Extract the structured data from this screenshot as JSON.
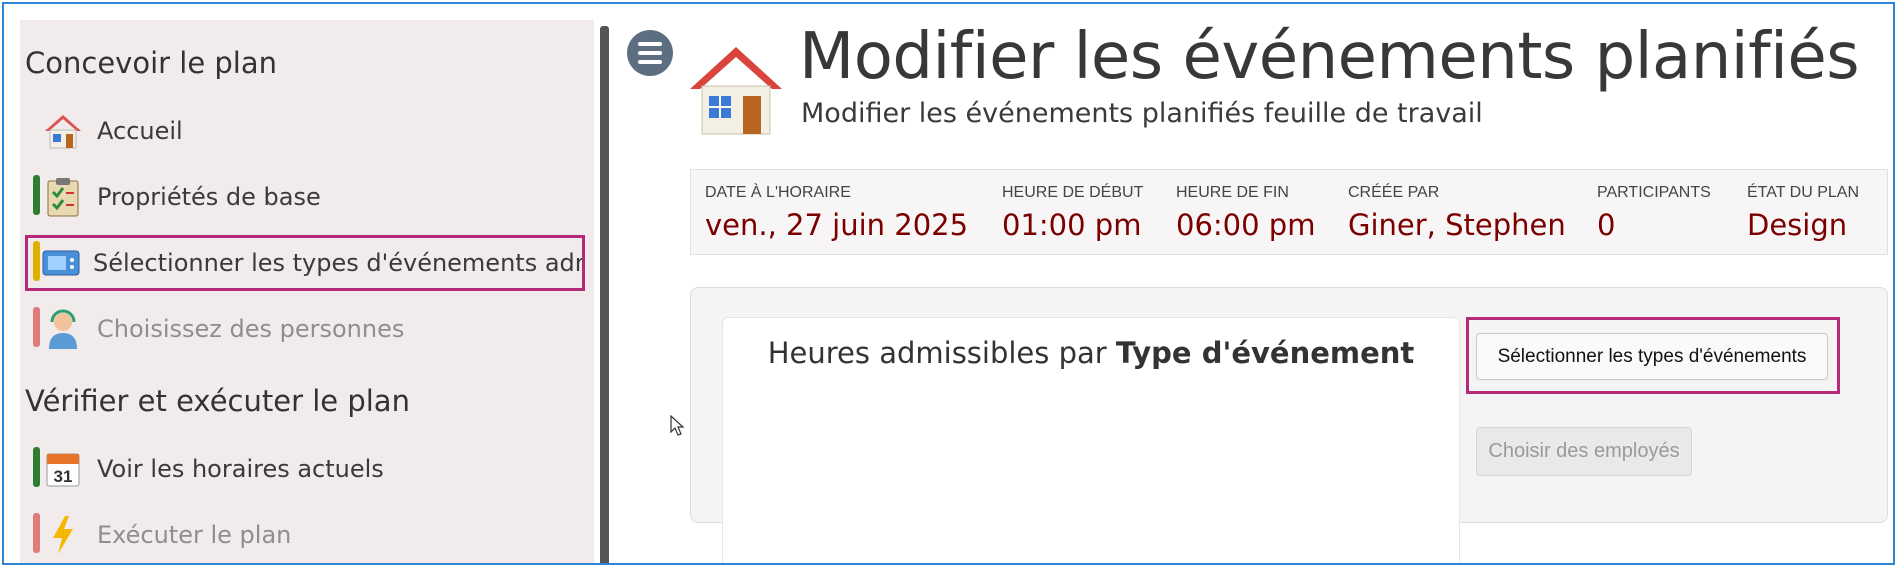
{
  "sidebar": {
    "sections": [
      {
        "title": "Concevoir le plan",
        "items": [
          {
            "label": "Accueil",
            "icon": "house-icon",
            "disabled": false
          },
          {
            "label": "Propriétés de base",
            "icon": "clipboard-check-icon",
            "disabled": false
          },
          {
            "label": "Sélectionner les types d'événements admissib",
            "icon": "monitor-icon",
            "disabled": false,
            "active": true
          },
          {
            "label": "Choisissez des personnes",
            "icon": "person-headset-icon",
            "disabled": true
          }
        ]
      },
      {
        "title": "Vérifier et exécuter le plan",
        "items": [
          {
            "label": "Voir les horaires actuels",
            "icon": "calendar-31-icon",
            "disabled": false
          },
          {
            "label": "Exécuter le plan",
            "icon": "lightning-icon",
            "disabled": true
          }
        ]
      }
    ]
  },
  "header": {
    "title": "Modifier les événements planifiés",
    "subtitle": "Modifier les événements planifiés feuille de travail"
  },
  "info": [
    {
      "label": "DATE À L'HORAIRE",
      "value": "ven., 27 juin 2025"
    },
    {
      "label": "HEURE DE DÉBUT",
      "value": "01:00 pm"
    },
    {
      "label": "HEURE DE FIN",
      "value": "06:00 pm"
    },
    {
      "label": "CRÉÉE PAR",
      "value": "Giner, Stephen"
    },
    {
      "label": "PARTICIPANTS",
      "value": "0"
    },
    {
      "label": "ÉTAT DU PLAN",
      "value": "Design"
    }
  ],
  "card": {
    "title_prefix": "Heures admissibles par",
    "title_bold": "Type d'événement"
  },
  "buttons": {
    "select_types": "Sélectionner les types d'événements",
    "choose_employees": "Choisir des employés"
  },
  "colors": {
    "highlight": "#b5297a",
    "value_text": "#7a0000",
    "frame_border": "#2f86d8",
    "sidebar_bg": "#f1ebeb"
  }
}
